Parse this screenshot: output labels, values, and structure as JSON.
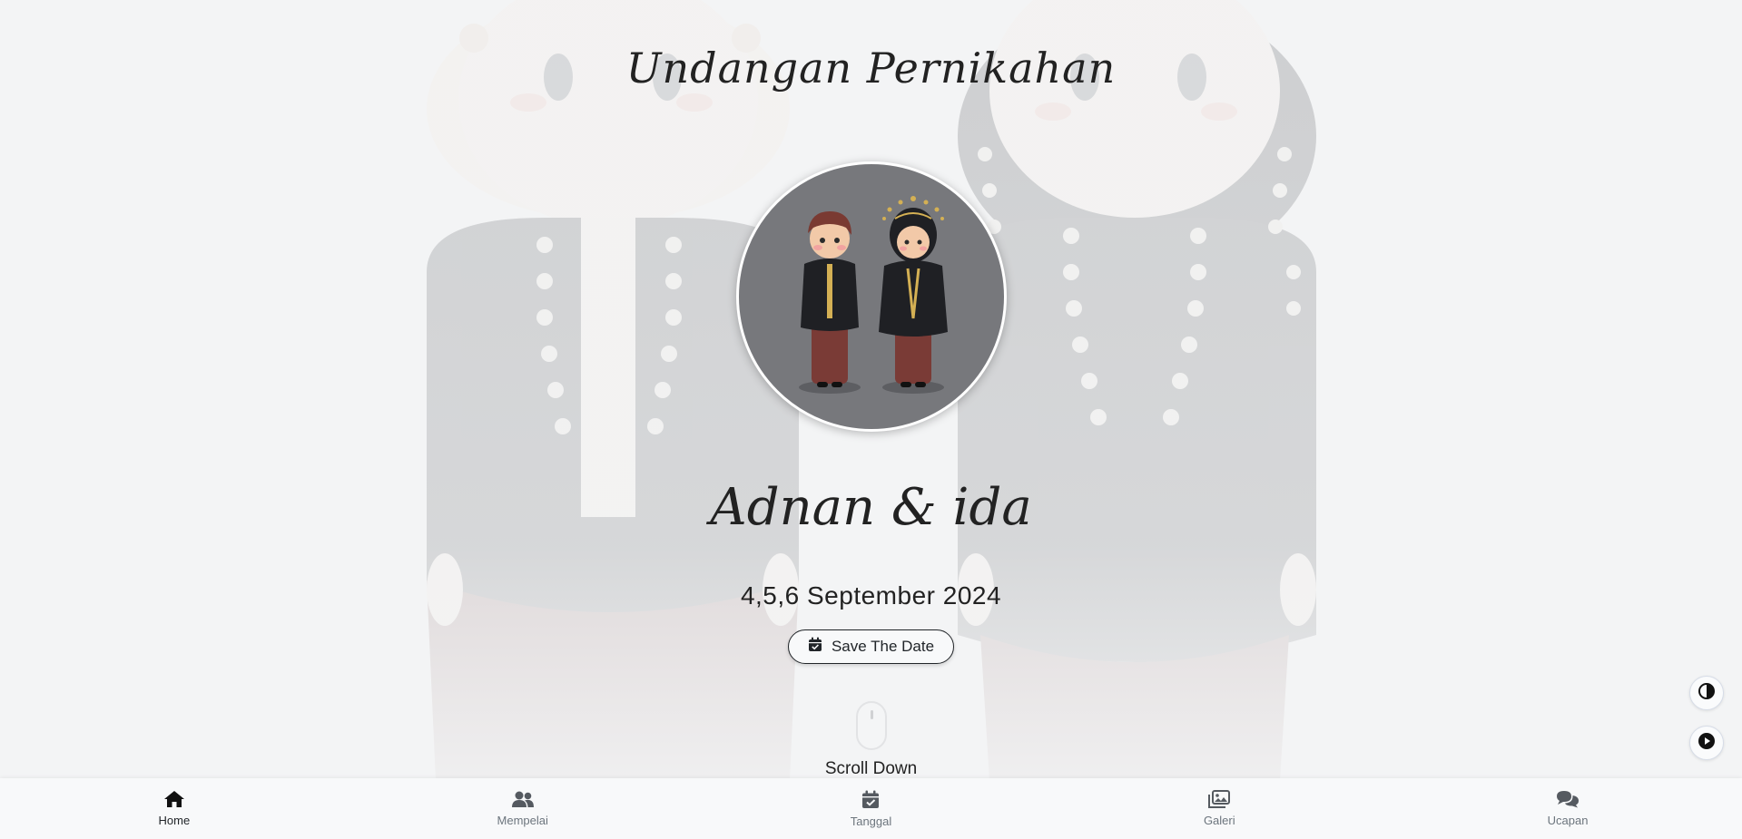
{
  "hero": {
    "title": "Undangan Pernikahan",
    "couple_names": "Adnan & ida",
    "date": "4,5,6 September 2024",
    "save_date_label": "Save The Date",
    "scroll_label": "Scroll Down"
  },
  "side_buttons": {
    "theme_toggle_icon": "contrast-icon",
    "music_icon": "play-circle-icon"
  },
  "bottom_nav": {
    "items": [
      {
        "label": "Home",
        "icon": "home-icon",
        "active": true
      },
      {
        "label": "Mempelai",
        "icon": "users-icon",
        "active": false
      },
      {
        "label": "Tanggal",
        "icon": "calendar-check-icon",
        "active": false
      },
      {
        "label": "Galeri",
        "icon": "images-icon",
        "active": false
      },
      {
        "label": "Ucapan",
        "icon": "comments-icon",
        "active": false
      }
    ]
  },
  "colors": {
    "background": "#f3f4f5",
    "text": "#212529",
    "nav_inactive": "#6c757d",
    "avatar_bg": "#77787c"
  }
}
